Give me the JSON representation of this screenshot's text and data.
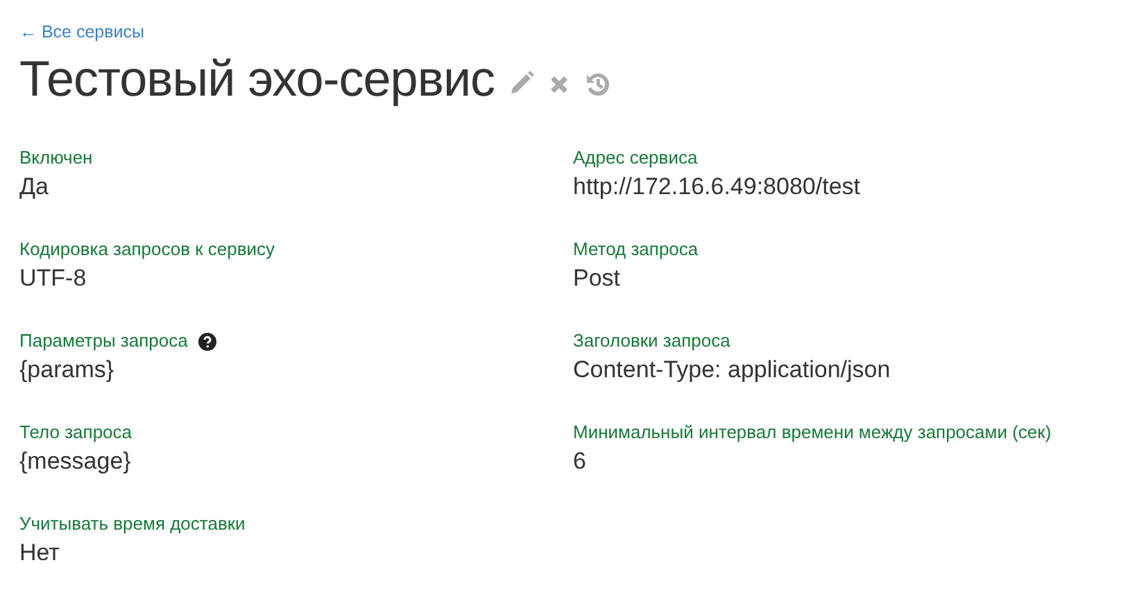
{
  "back_link": "← Все сервисы",
  "title": "Тестовый эхо-сервис",
  "left_column": [
    {
      "label": "Включен",
      "value": "Да"
    },
    {
      "label": "Кодировка запросов к сервису",
      "value": "UTF-8"
    },
    {
      "label": "Параметры запроса",
      "value": "{params}",
      "has_help": true
    },
    {
      "label": "Тело запроса",
      "value": "{message}"
    },
    {
      "label": "Учитывать время доставки",
      "value": "Нет"
    }
  ],
  "right_column": [
    {
      "label": "Адрес сервиса",
      "value": "http://172.16.6.49:8080/test"
    },
    {
      "label": "Метод запроса",
      "value": "Post"
    },
    {
      "label": "Заголовки запроса",
      "value": "Content-Type: application/json"
    },
    {
      "label": "Минимальный интервал времени между запросами (сек)",
      "value": "6"
    }
  ]
}
